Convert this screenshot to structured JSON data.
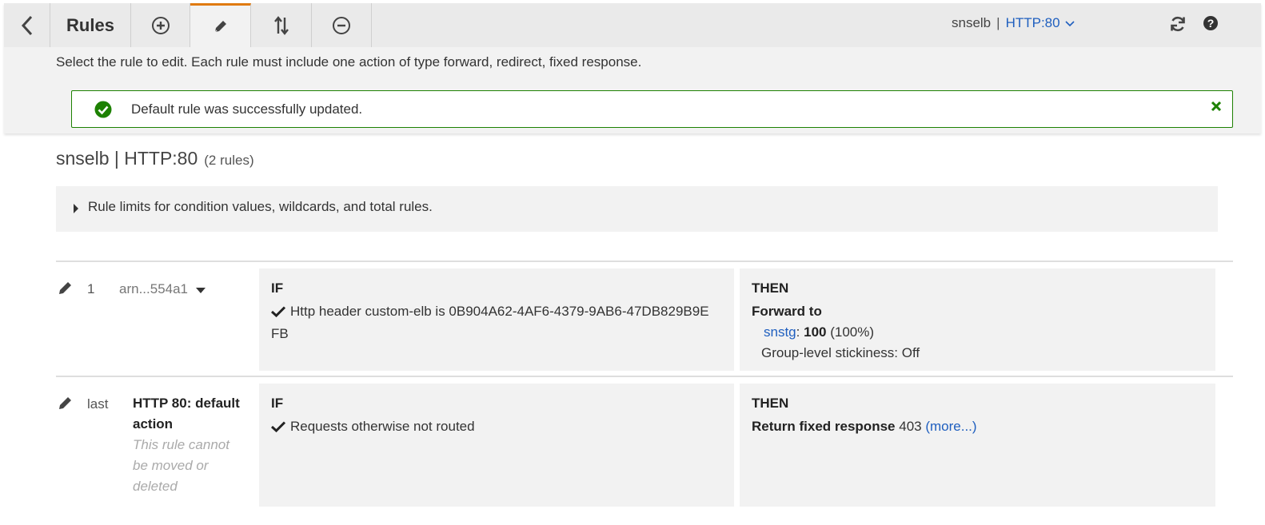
{
  "toolbar": {
    "title": "Rules",
    "listener": {
      "load_balancer": "snselb",
      "separator": "|",
      "name": "HTTP:80"
    }
  },
  "instruction": "Select the rule to edit. Each rule must include one action of type forward, redirect, fixed response.",
  "alert": {
    "message": "Default rule was successfully updated."
  },
  "header": {
    "title": "snselb | HTTP:80",
    "count": "(2 rules)"
  },
  "limits": {
    "label": "Rule limits for condition values, wildcards, and total rules."
  },
  "rules": [
    {
      "priority": "1",
      "arn": "arn...554a1",
      "if_label": "IF",
      "condition_prefix": "Http header custom-elb is ",
      "condition_value": "0B904A62-4AF6-4379-9AB6-47DB829B9E",
      "condition_value_wrap": "FB",
      "then_label": "THEN",
      "action": "Forward to",
      "target_group": "snstg",
      "target_colon": ":",
      "weight": "100",
      "weight_pct": "(100%)",
      "stickiness": "Group-level stickiness: Off"
    },
    {
      "priority": "last",
      "name": "HTTP 80: default action",
      "note": "This rule cannot be moved or deleted",
      "if_label": "IF",
      "condition": "Requests otherwise not routed",
      "then_label": "THEN",
      "action": "Return fixed response",
      "status_code": "403",
      "more": "(more...)"
    }
  ],
  "colors": {
    "accent_tab": "#e07a10",
    "link": "#1f5fbf",
    "success": "#1d8102"
  },
  "icons": [
    "back-icon",
    "add-icon",
    "edit-icon",
    "reorder-icon",
    "delete-icon",
    "chevron-down-icon",
    "refresh-icon",
    "help-icon",
    "success-icon",
    "close-icon",
    "caret-right-icon",
    "pencil-icon",
    "checkmark-icon",
    "dropdown-caret-icon"
  ]
}
